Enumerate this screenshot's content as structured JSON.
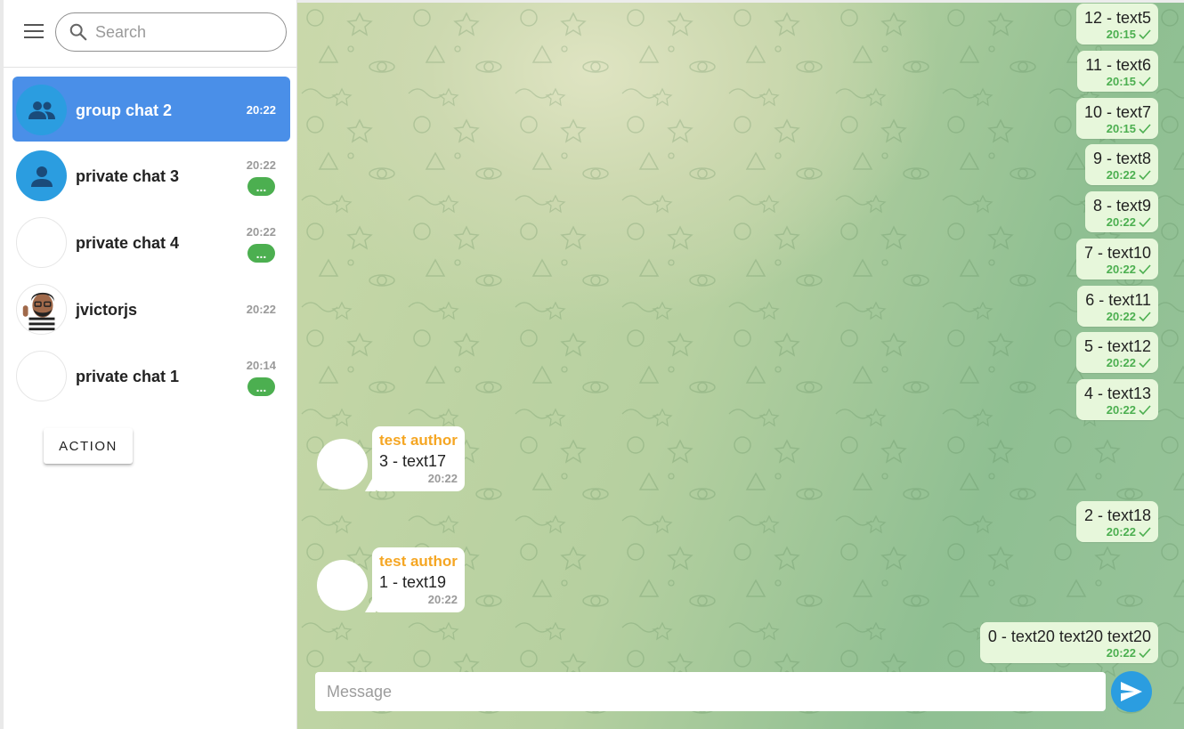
{
  "search": {
    "placeholder": "Search"
  },
  "chats": [
    {
      "name": "group chat 2",
      "time": "20:22",
      "badge": "",
      "avatar": "group-icon"
    },
    {
      "name": "private chat 3",
      "time": "20:22",
      "badge": "...",
      "avatar": "person-icon"
    },
    {
      "name": "private chat 4",
      "time": "20:22",
      "badge": "...",
      "avatar": "blank"
    },
    {
      "name": "jvictorjs",
      "time": "20:22",
      "badge": "",
      "avatar": "photo"
    },
    {
      "name": "private chat 1",
      "time": "20:14",
      "badge": "...",
      "avatar": "blank"
    }
  ],
  "action_label": "ACTION",
  "messages_out": [
    {
      "text": "12 - text5",
      "time": "20:15"
    },
    {
      "text": "11 - text6",
      "time": "20:15"
    },
    {
      "text": "10 - text7",
      "time": "20:15"
    },
    {
      "text": "9 - text8",
      "time": "20:22"
    },
    {
      "text": "8 - text9",
      "time": "20:22"
    },
    {
      "text": "7 - text10",
      "time": "20:22"
    },
    {
      "text": "6 - text11",
      "time": "20:22"
    },
    {
      "text": "5 - text12",
      "time": "20:22"
    },
    {
      "text": "4 - text13",
      "time": "20:22"
    },
    {
      "text": "2 - text18",
      "time": "20:22"
    },
    {
      "text": "0 - text20 text20 text20",
      "time": "20:22"
    }
  ],
  "messages_in": [
    {
      "author": "test author",
      "text": "3 - text17",
      "time": "20:22"
    },
    {
      "author": "test author",
      "text": "1 - text19",
      "time": "20:22"
    }
  ],
  "composer": {
    "placeholder": "Message"
  },
  "colors": {
    "accent": "#4a8fe8",
    "send": "#2b9de0",
    "badge": "#4caf50",
    "author": "#f5a623",
    "outgoing_bubble": "#e7f7db"
  }
}
